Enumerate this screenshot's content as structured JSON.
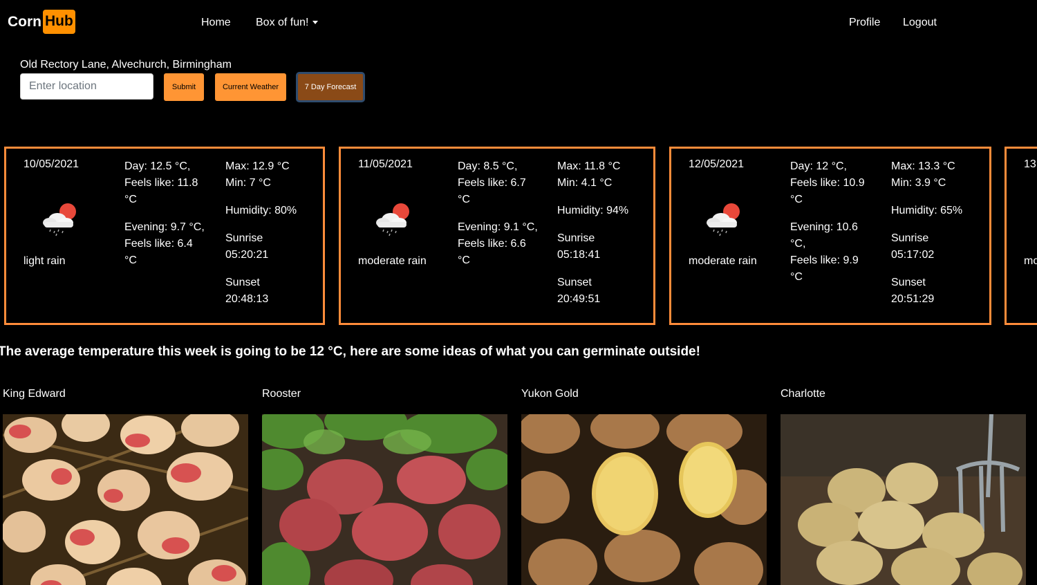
{
  "navbar": {
    "brand_part1": "Corn",
    "brand_part2": "Hub",
    "home": "Home",
    "box_of_fun": "Box of fun!",
    "profile": "Profile",
    "logout": "Logout"
  },
  "location": {
    "label": "Old Rectory Lane, Alvechurch, Birmingham",
    "placeholder": "Enter location",
    "submit": "Submit",
    "current_weather": "Current Weather",
    "seven_day": "7 Day Forecast"
  },
  "forecast": [
    {
      "date": "10/05/2021",
      "desc": "light rain",
      "day_temp": "Day: 12.5 °C,",
      "day_feels_1": "Feels like: 11.8",
      "day_feels_2": "°C",
      "eve_1": "Evening: 9.7 °C,",
      "eve_2": "Feels like: 6.4",
      "eve_3": "°C",
      "max": "Max: 12.9 °C",
      "min": "Min: 7 °C",
      "humidity": "Humidity: 80%",
      "sunrise_label": "Sunrise",
      "sunrise": "05:20:21",
      "sunset_label": "Sunset",
      "sunset": "20:48:13"
    },
    {
      "date": "11/05/2021",
      "desc": "moderate rain",
      "day_temp": "Day: 8.5 °C,",
      "day_feels_1": "Feels like: 6.7",
      "day_feels_2": "°C",
      "eve_1": "Evening: 9.1 °C,",
      "eve_2": "Feels like: 6.6",
      "eve_3": "°C",
      "max": "Max: 11.8 °C",
      "min": "Min: 4.1 °C",
      "humidity": "Humidity: 94%",
      "sunrise_label": "Sunrise",
      "sunrise": "05:18:41",
      "sunset_label": "Sunset",
      "sunset": "20:49:51"
    },
    {
      "date": "12/05/2021",
      "desc": "moderate rain",
      "day_temp": "Day: 12 °C,",
      "day_feels_1": "Feels like: 10.9",
      "day_feels_2": "°C",
      "eve_1": "Evening: 10.6",
      "eve_2": "°C,",
      "eve_3": "Feels like: 9.9",
      "eve_4": "°C",
      "max": "Max: 13.3 °C",
      "min": "Min: 3.9 °C",
      "humidity": "Humidity: 65%",
      "sunrise_label": "Sunrise",
      "sunrise": "05:17:02",
      "sunset_label": "Sunset",
      "sunset": "20:51:29"
    },
    {
      "date": "13,",
      "desc": "mo"
    }
  ],
  "average_text": "The average temperature this week is going to be 12 °C, here are some ideas of what you can germinate outside!",
  "potatoes": [
    {
      "name": "King Edward"
    },
    {
      "name": "Rooster"
    },
    {
      "name": "Yukon Gold"
    },
    {
      "name": "Charlotte"
    }
  ],
  "icons": {
    "brand": "cornhub-logo",
    "weather": "rain-cloud-sun-icon",
    "dropdown": "caret-down-icon"
  },
  "colors": {
    "accent": "#ff9534",
    "card_border": "#ff8c3a",
    "active_button": "#8a4a17",
    "brand_orange": "#ff9000"
  }
}
